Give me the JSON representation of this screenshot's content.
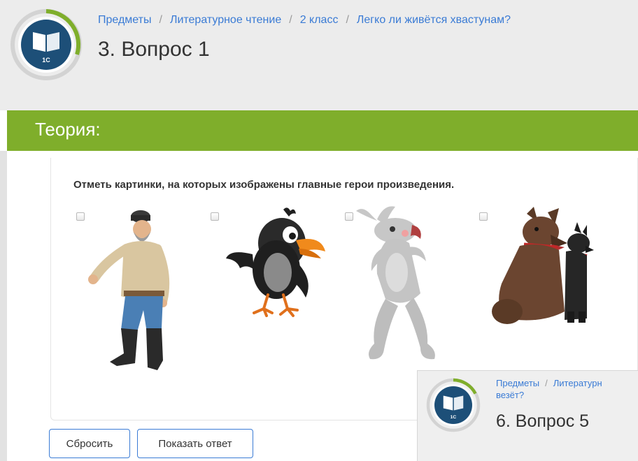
{
  "header": {
    "breadcrumbs": [
      "Предметы",
      "Литературное чтение",
      "2 класс",
      "Легко ли живётся хвастунам?"
    ],
    "title": "3. Вопрос 1",
    "logo_text": "1С"
  },
  "theory": {
    "title": "Теория:"
  },
  "question": {
    "instruction": "Отметь картинки, на которых изображены главные герои произведения.",
    "options": [
      {
        "picture": "old-man",
        "checked": false
      },
      {
        "picture": "crow",
        "checked": false
      },
      {
        "picture": "hare",
        "checked": false
      },
      {
        "picture": "dogs",
        "checked": false
      }
    ]
  },
  "buttons": {
    "reset": "Сбросить",
    "show_answer": "Показать ответ"
  },
  "overlay": {
    "breadcrumbs": [
      "Предметы",
      "Литературн"
    ],
    "breadcrumb_line2": "везёт?",
    "title": "6. Вопрос 5",
    "logo_text": "1С"
  },
  "colors": {
    "accent_green": "#7fae2b",
    "link_blue": "#3a7bd5",
    "logo_navy": "#1d4f78"
  }
}
